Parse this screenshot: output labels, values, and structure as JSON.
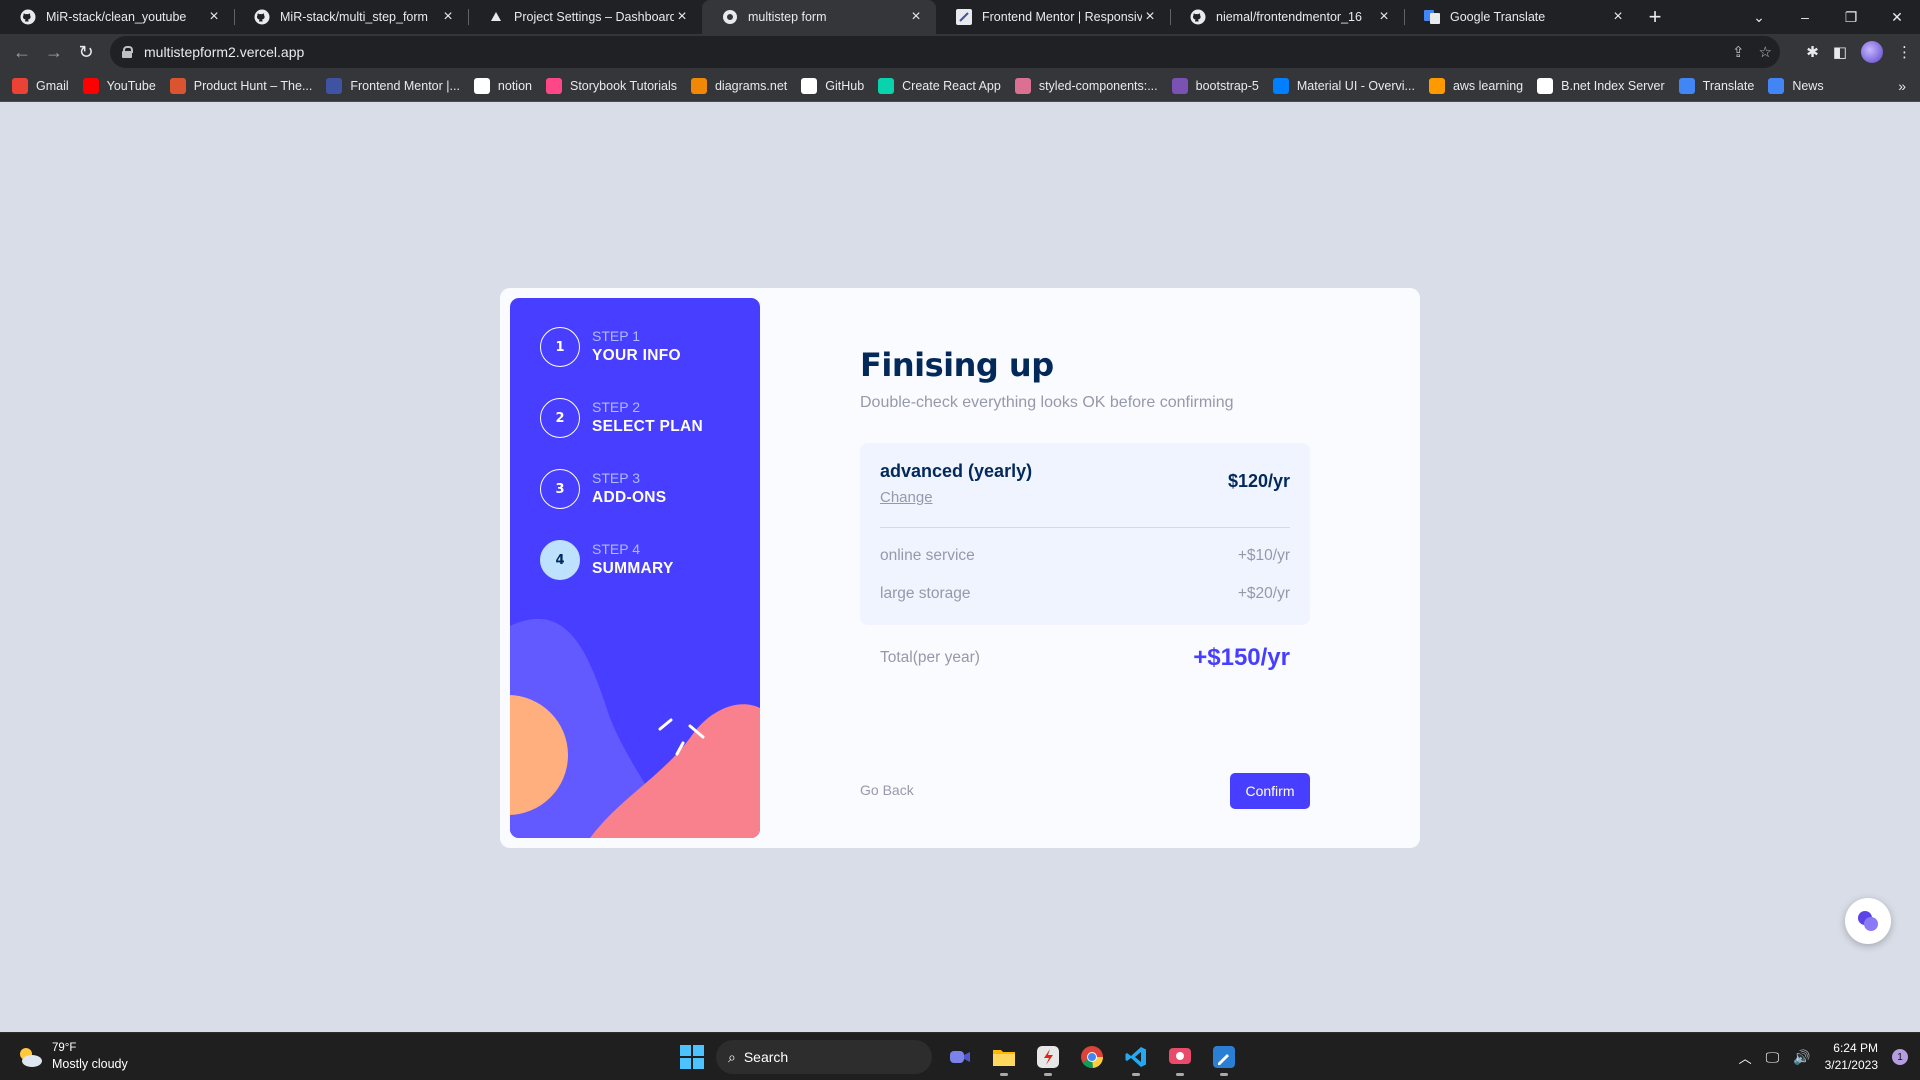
{
  "browser": {
    "tabs": [
      {
        "title": "MiR-stack/clean_youtube",
        "icon": "github-icon"
      },
      {
        "title": "MiR-stack/multi_step_form",
        "icon": "github-icon"
      },
      {
        "title": "Project Settings – Dashboard – V",
        "icon": "vercel-icon"
      },
      {
        "title": "multistep form",
        "icon": "globe-icon",
        "active": true
      },
      {
        "title": "Frontend Mentor | Responsive in",
        "icon": "frontend-mentor-icon"
      },
      {
        "title": "niemal/frontendmentor_16",
        "icon": "github-icon"
      },
      {
        "title": "Google Translate",
        "icon": "translate-icon"
      }
    ],
    "url": "multistepform2.vercel.app",
    "bookmarks": [
      {
        "label": "Gmail",
        "color": "#ea4335"
      },
      {
        "label": "YouTube",
        "color": "#ff0000"
      },
      {
        "label": "Product Hunt – The...",
        "color": "#da552f"
      },
      {
        "label": "Frontend Mentor |...",
        "color": "#3e54a3"
      },
      {
        "label": "notion",
        "color": "#ffffff"
      },
      {
        "label": "Storybook Tutorials",
        "color": "#ff4785"
      },
      {
        "label": "diagrams.net",
        "color": "#f08705"
      },
      {
        "label": "GitHub",
        "color": "#ffffff"
      },
      {
        "label": "Create React App",
        "color": "#09d3ac"
      },
      {
        "label": "styled-components:...",
        "color": "#db7093"
      },
      {
        "label": "bootstrap-5",
        "color": "#7952b3"
      },
      {
        "label": "Material UI - Overvi...",
        "color": "#007fff"
      },
      {
        "label": "aws learning",
        "color": "#ff9900"
      },
      {
        "label": "B.net Index Server",
        "color": "#ffffff"
      },
      {
        "label": "Translate",
        "color": "#4285f4"
      },
      {
        "label": "News",
        "color": "#4285f4"
      }
    ]
  },
  "sidebar": {
    "steps": [
      {
        "number": "1",
        "label": "STEP 1",
        "title": "YOUR INFO"
      },
      {
        "number": "2",
        "label": "STEP 2",
        "title": "SELECT PLAN"
      },
      {
        "number": "3",
        "label": "STEP 3",
        "title": "ADD-ONS"
      },
      {
        "number": "4",
        "label": "STEP 4",
        "title": "SUMMARY",
        "active": true
      }
    ]
  },
  "summary": {
    "title": "Finising up",
    "subtitle": "Double-check everything looks OK before confirming",
    "plan": {
      "name": "advanced (yearly)",
      "change_label": "Change",
      "price": "$120/yr"
    },
    "addons": [
      {
        "name": "online service",
        "price": "+$10/yr"
      },
      {
        "name": "large storage",
        "price": "+$20/yr"
      }
    ],
    "total_label": "Total(per year)",
    "total_value": "+$150/yr",
    "back_label": "Go Back",
    "confirm_label": "Confirm"
  },
  "colors": {
    "accent": "#483eff",
    "sidebar_active_step": "#bee2fd",
    "heading": "#022959",
    "muted": "#9699aa",
    "page_background": "#d9dde7"
  },
  "taskbar": {
    "weather_temp": "79°F",
    "weather_condition": "Mostly cloudy",
    "search_label": "Search",
    "time": "6:24 PM",
    "date": "3/21/2023",
    "notification_count": "1"
  }
}
